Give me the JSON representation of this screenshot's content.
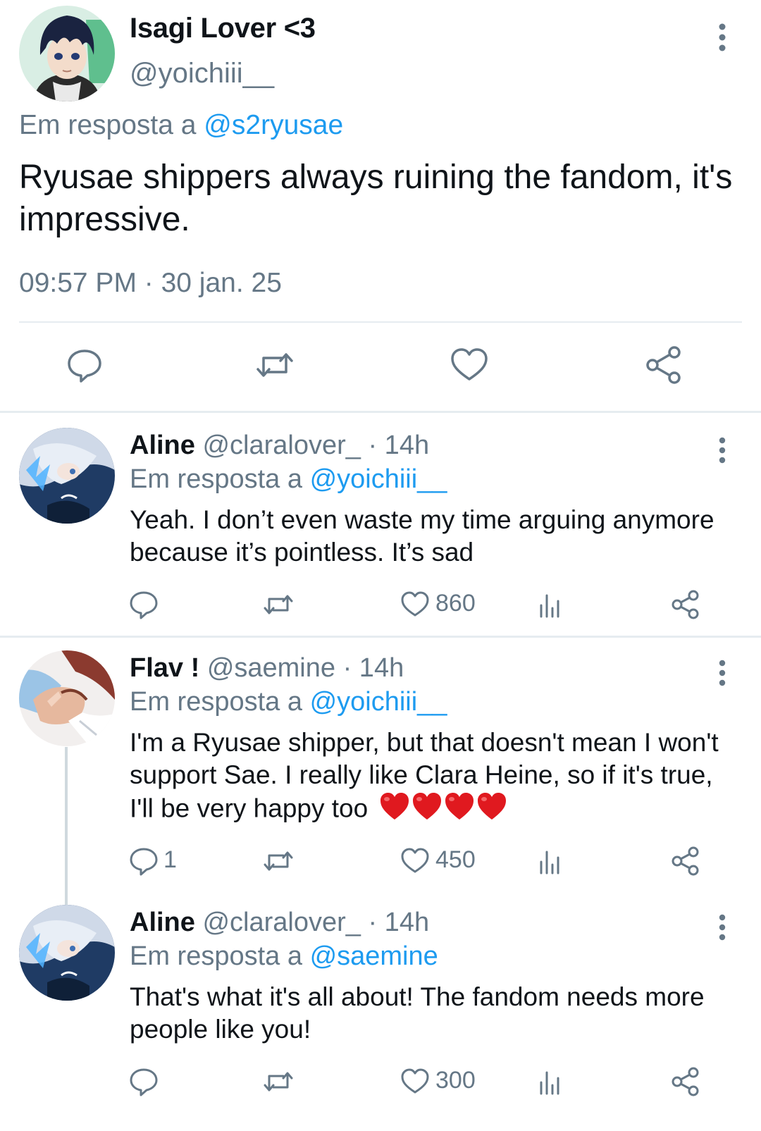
{
  "main_tweet": {
    "display_name": "Isagi Lover <3",
    "handle": "@yoichiii__",
    "reply_prefix": "Em resposta a",
    "reply_target": "@s2ryusae",
    "text": "Ryusae shippers always ruining the fandom, it's impressive.",
    "timestamp": "09:57 PM · 30 jan. 25",
    "icons": [
      "reply-icon",
      "retweet-icon",
      "like-icon",
      "share-icon"
    ]
  },
  "replies": [
    {
      "display_name": "Aline",
      "handle": "@claralover_",
      "time": "· 14h",
      "reply_prefix": "Em resposta a",
      "reply_target": "@yoichiii__",
      "text": "Yeah. I don’t even waste my time arguing anymore because it’s pointless. It’s sad",
      "reply_count": "",
      "like_count": "860"
    },
    {
      "display_name": "Flav !",
      "handle": "@saemine",
      "time": "· 14h",
      "reply_prefix": "Em resposta a",
      "reply_target": "@yoichiii__",
      "text": "I'm a Ryusae shipper, but that doesn't mean I won't support Sae. I really like Clara Heine, so if it's true, I'll be very happy too",
      "emoji": "❤️❤️❤️❤️",
      "reply_count": "1",
      "like_count": "450"
    },
    {
      "display_name": "Aline",
      "handle": "@claralover_",
      "time": "· 14h",
      "reply_prefix": "Em resposta a",
      "reply_target": "@saemine",
      "text": "That's what it's all about! The fandom needs more people like you!",
      "reply_count": "",
      "like_count": "300"
    }
  ],
  "colors": {
    "link": "#1d9bf0",
    "muted": "#657786",
    "text": "#0f1419",
    "divider": "#e6ecf0",
    "heart": "#e0191f"
  }
}
